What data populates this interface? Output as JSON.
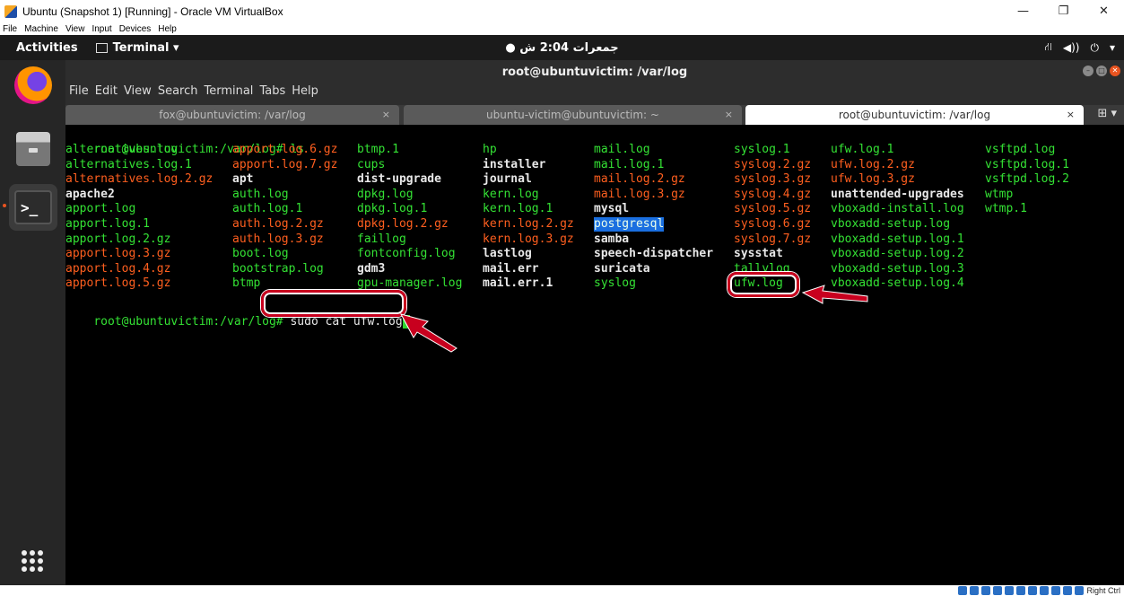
{
  "host": {
    "title": "Ubuntu (Snapshot 1) [Running] - Oracle VM VirtualBox",
    "menu": [
      "File",
      "Machine",
      "View",
      "Input",
      "Devices",
      "Help"
    ],
    "status_key": "Right Ctrl"
  },
  "gnome": {
    "activities": "Activities",
    "app_menu": "Terminal ▾",
    "clock": "● جمعرات 2:04 ش",
    "tray": [
      "⛙",
      "◀))",
      "⏻",
      "▾"
    ]
  },
  "terminal": {
    "title": "root@ubuntuvictim: /var/log",
    "menu": [
      "File",
      "Edit",
      "View",
      "Search",
      "Terminal",
      "Tabs",
      "Help"
    ],
    "tabs": [
      {
        "label": "fox@ubuntuvictim: /var/log",
        "active": false
      },
      {
        "label": "ubuntu-victim@ubuntuvictim: ~",
        "active": false
      },
      {
        "label": "root@ubuntuvictim: /var/log",
        "active": true
      }
    ],
    "prompt": "root@ubuntuvictim:/var/log#",
    "first_command": " ls",
    "typed_command": " sudo cat ufw.log",
    "listing": [
      [
        "alternatives.log",
        "apport.log.6.gz",
        "btmp.1",
        "hp",
        "mail.log",
        "syslog.1",
        "ufw.log.1",
        "vsftpd.log"
      ],
      [
        "alternatives.log.1",
        "apport.log.7.gz",
        "cups",
        "installer",
        "mail.log.1",
        "syslog.2.gz",
        "ufw.log.2.gz",
        "vsftpd.log.1"
      ],
      [
        "alternatives.log.2.gz",
        "apt",
        "dist-upgrade",
        "journal",
        "mail.log.2.gz",
        "syslog.3.gz",
        "ufw.log.3.gz",
        "vsftpd.log.2"
      ],
      [
        "apache2",
        "auth.log",
        "dpkg.log",
        "kern.log",
        "mail.log.3.gz",
        "syslog.4.gz",
        "unattended-upgrades",
        "wtmp"
      ],
      [
        "apport.log",
        "auth.log.1",
        "dpkg.log.1",
        "kern.log.1",
        "mysql",
        "syslog.5.gz",
        "vboxadd-install.log",
        "wtmp.1"
      ],
      [
        "apport.log.1",
        "auth.log.2.gz",
        "dpkg.log.2.gz",
        "kern.log.2.gz",
        "postgresql",
        "syslog.6.gz",
        "vboxadd-setup.log",
        ""
      ],
      [
        "apport.log.2.gz",
        "auth.log.3.gz",
        "faillog",
        "kern.log.3.gz",
        "samba",
        "syslog.7.gz",
        "vboxadd-setup.log.1",
        ""
      ],
      [
        "apport.log.3.gz",
        "boot.log",
        "fontconfig.log",
        "lastlog",
        "speech-dispatcher",
        "sysstat",
        "vboxadd-setup.log.2",
        ""
      ],
      [
        "apport.log.4.gz",
        "bootstrap.log",
        "gdm3",
        "mail.err",
        "suricata",
        "tallylog",
        "vboxadd-setup.log.3",
        ""
      ],
      [
        "apport.log.5.gz",
        "btmp",
        "gpu-manager.log",
        "mail.err.1",
        "syslog",
        "ufw.log",
        "vboxadd-setup.log.4",
        ""
      ]
    ],
    "listing_colors": [
      [
        "green",
        "red",
        "green",
        "green",
        "green",
        "green",
        "green",
        "green"
      ],
      [
        "green",
        "red",
        "green",
        "white",
        "green",
        "red",
        "red",
        "green"
      ],
      [
        "red",
        "white",
        "white",
        "white",
        "red",
        "red",
        "red",
        "green"
      ],
      [
        "white",
        "green",
        "green",
        "green",
        "red",
        "red",
        "white",
        "green"
      ],
      [
        "green",
        "green",
        "green",
        "green",
        "white",
        "red",
        "green",
        "green"
      ],
      [
        "green",
        "red",
        "red",
        "red",
        "blue",
        "red",
        "green",
        ""
      ],
      [
        "green",
        "red",
        "green",
        "red",
        "white",
        "red",
        "green",
        ""
      ],
      [
        "red",
        "green",
        "green",
        "white",
        "white",
        "white",
        "green",
        ""
      ],
      [
        "red",
        "green",
        "white",
        "white",
        "white",
        "green",
        "green",
        ""
      ],
      [
        "red",
        "green",
        "green",
        "white",
        "green",
        "green",
        "green",
        ""
      ]
    ]
  },
  "colors": {
    "green": "#34e234",
    "red": "#ff5f1f",
    "white": "#e8e8e8",
    "annotation": "#c8001e",
    "ubuntu_orange": "#e95420"
  }
}
